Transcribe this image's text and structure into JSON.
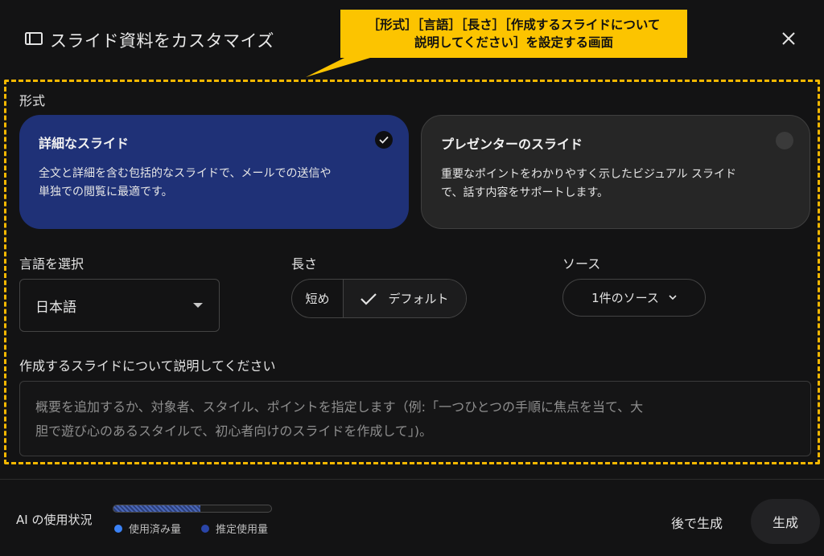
{
  "header": {
    "title": "スライド資料をカスタマイズ",
    "icon": "slides-icon"
  },
  "callout": {
    "line1": "［形式］［言語］［長さ］［作成するスライドについて",
    "line2": "説明してください］を設定する画面",
    "color": "#fcc400"
  },
  "format": {
    "label": "形式",
    "options": [
      {
        "title": "詳細なスライド",
        "desc_line1": "全文と詳細を含む包括的なスライドで、メールでの送信や",
        "desc_line2": "単独での閲覧に最適です。",
        "selected": true
      },
      {
        "title": "プレゼンターのスライド",
        "desc_line1": "重要なポイントをわかりやすく示したビジュアル スライド",
        "desc_line2": "で、話す内容をサポートします。",
        "selected": false
      }
    ]
  },
  "language": {
    "label": "言語を選択",
    "value": "日本語"
  },
  "length": {
    "label": "長さ",
    "options": [
      "短め",
      "デフォルト"
    ],
    "selected": "デフォルト"
  },
  "source": {
    "label": "ソース",
    "value": "1件のソース"
  },
  "description": {
    "label": "作成するスライドについて説明してください",
    "placeholder_line1": "概要を追加するか、対象者、スタイル、ポイントを指定します（例:「一つひとつの手順に焦点を当て、大",
    "placeholder_line2": "胆で遊び心のあるスタイルで、初心者向けのスライドを作成して」)。"
  },
  "usage": {
    "label": "AI の使用状況",
    "used_fraction": 0.55,
    "legend_used": "使用済み量",
    "legend_estimated": "推定使用量",
    "used_color": "#3b82f6",
    "estimated_color": "#2a45a8"
  },
  "actions": {
    "later": "後で生成",
    "generate": "生成"
  },
  "colors": {
    "accent_selected": "#1f3177",
    "highlight": "#f5b700"
  }
}
